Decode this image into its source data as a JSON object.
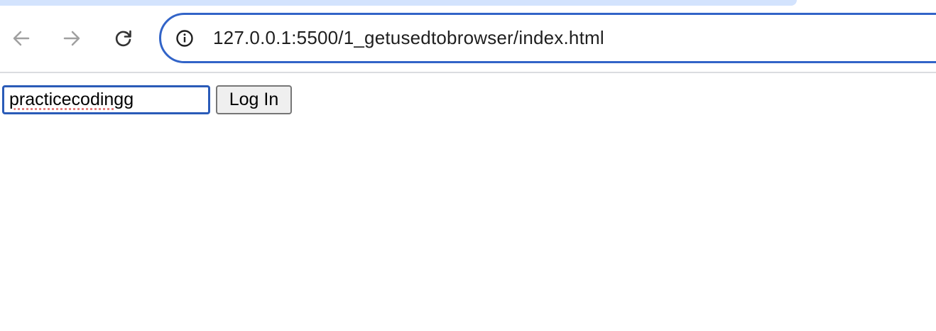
{
  "browser": {
    "url": "127.0.0.1:5500/1_getusedtobrowser/index.html",
    "icons": {
      "back": "arrow-left-icon",
      "forward": "arrow-right-icon",
      "reload": "reload-icon",
      "site_info": "info-icon"
    },
    "accent_color": "#3264c8",
    "tab_strip_color": "#d3e3fd"
  },
  "page": {
    "username_value": "practicecodingg",
    "login_label": "Log In"
  }
}
